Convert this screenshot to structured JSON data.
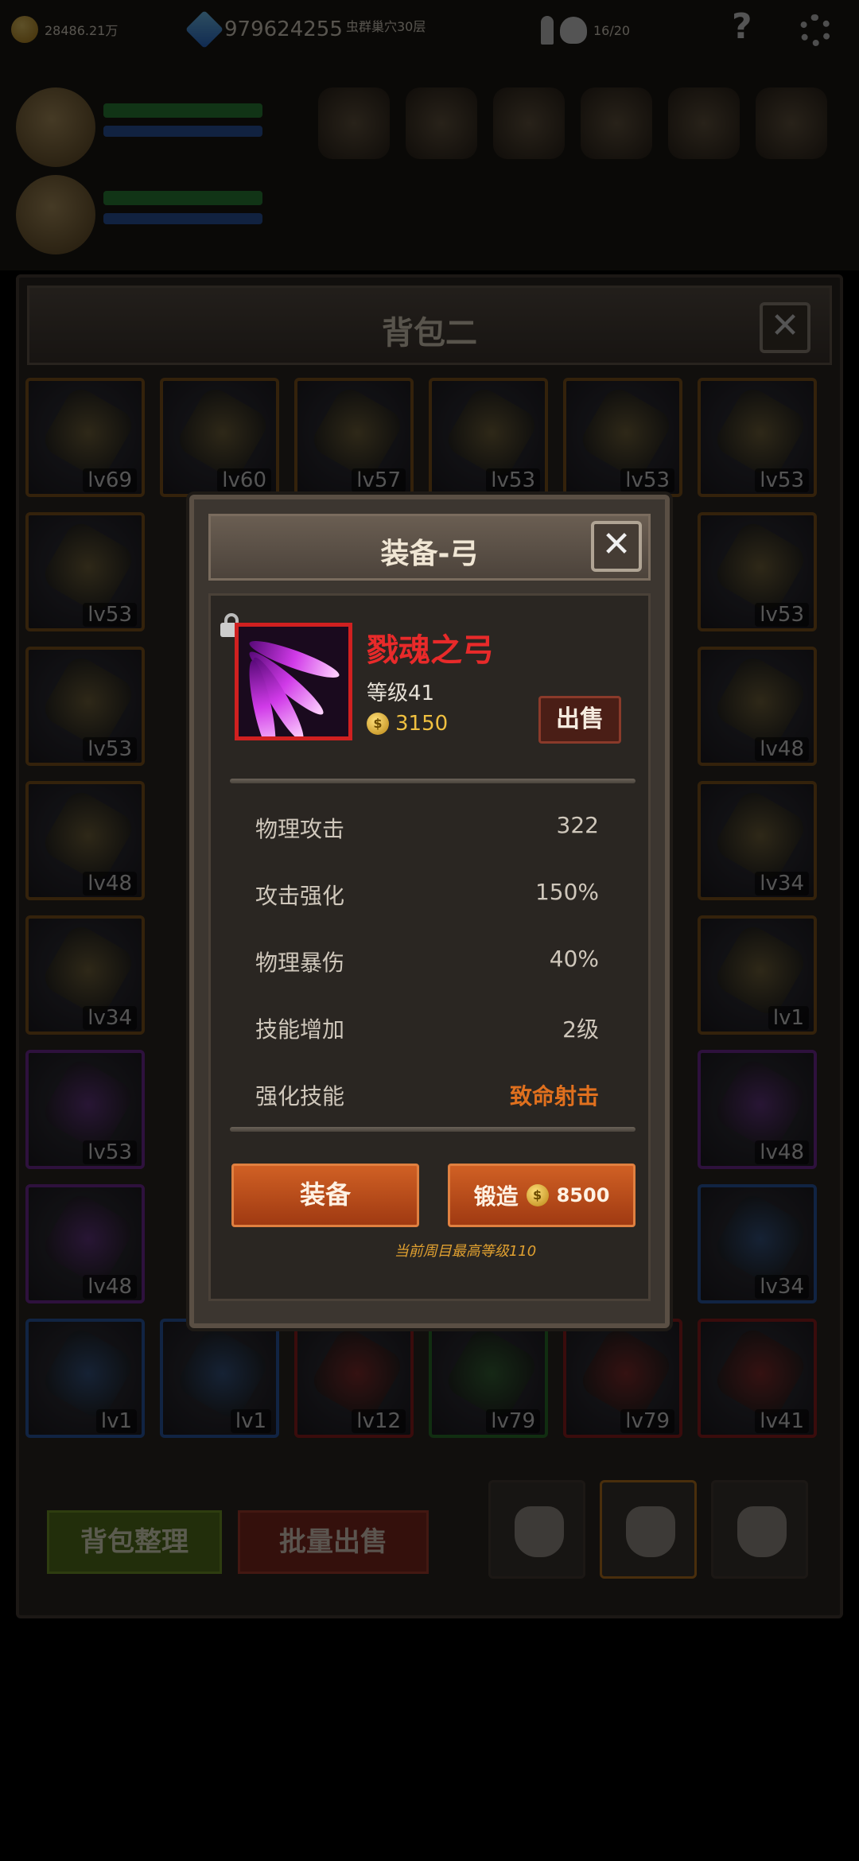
{
  "hud": {
    "gold": "28486.21万",
    "gems": "979624255",
    "stage": "虫群巢穴30层",
    "stamina": "16/20",
    "help": "?"
  },
  "bag": {
    "title": "背包二",
    "close": "✕",
    "slots": [
      {
        "lv": "lv69",
        "rarity": "orange"
      },
      {
        "lv": "lv60",
        "rarity": "orange"
      },
      {
        "lv": "lv57",
        "rarity": "orange"
      },
      {
        "lv": "lv53",
        "rarity": "orange"
      },
      {
        "lv": "lv53",
        "rarity": "orange"
      },
      {
        "lv": "lv53",
        "rarity": "orange"
      },
      {
        "lv": "lv53",
        "rarity": "orange"
      },
      {
        "lv": "lv53",
        "rarity": "orange"
      },
      {
        "lv": "lv53",
        "rarity": "orange"
      },
      {
        "lv": "lv48",
        "rarity": "orange"
      },
      {
        "lv": "lv48",
        "rarity": "orange"
      },
      {
        "lv": "lv34",
        "rarity": "orange"
      },
      {
        "lv": "lv34",
        "rarity": "orange"
      },
      {
        "lv": "lv1",
        "rarity": "orange"
      },
      {
        "lv": "lv53",
        "rarity": "purple"
      },
      {
        "lv": "lv48",
        "rarity": "purple"
      },
      {
        "lv": "lv48",
        "rarity": "purple"
      },
      {
        "lv": "lv34",
        "rarity": "blue"
      },
      {
        "lv": "lv1",
        "rarity": "blue"
      },
      {
        "lv": "lv1",
        "rarity": "blue"
      },
      {
        "lv": "lv12",
        "rarity": "red"
      },
      {
        "lv": "lv79",
        "rarity": "green"
      },
      {
        "lv": "lv79",
        "rarity": "red"
      },
      {
        "lv": "lv41",
        "rarity": "red"
      }
    ],
    "sort_label": "背包整理",
    "bulk_sell_label": "批量出售"
  },
  "dialog": {
    "title": "装备-弓",
    "close": "✕",
    "item": {
      "name": "戮魂之弓",
      "level": "等级41",
      "price": "3150",
      "sell_label": "出售"
    },
    "stats": [
      {
        "label": "物理攻击",
        "value": "322"
      },
      {
        "label": "攻击强化",
        "value": "150%"
      },
      {
        "label": "物理暴伤",
        "value": "40%"
      },
      {
        "label": "技能增加",
        "value": "2级"
      },
      {
        "label": "强化技能",
        "value": "致命射击"
      }
    ],
    "equip_label": "装备",
    "forge_label": "锻造",
    "forge_cost": "8500",
    "note": "当前周目最高等级110"
  },
  "colors": {
    "item_name": "#e82a2a",
    "skill_highlight": "#e0701e",
    "button": "#c0501c",
    "note": "#e0a030"
  }
}
